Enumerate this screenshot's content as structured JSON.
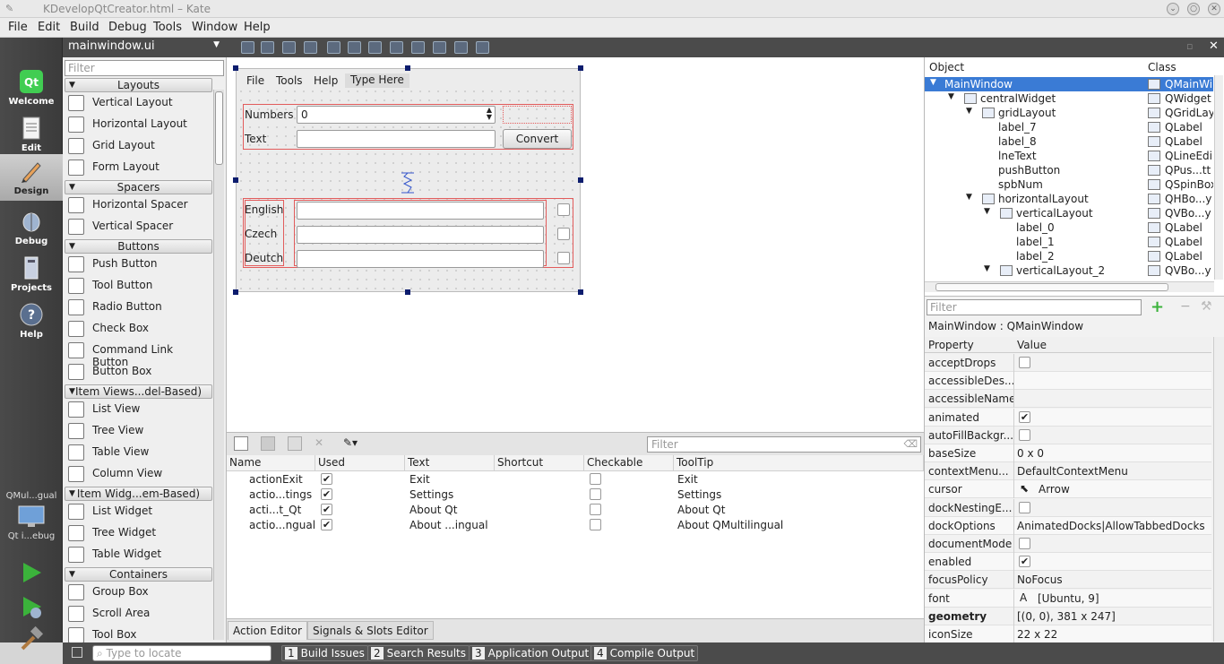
{
  "window": {
    "title": "KDevelopQtCreator.html – Kate"
  },
  "menu": [
    "File",
    "Edit",
    "Build",
    "Debug",
    "Tools",
    "Window",
    "Help"
  ],
  "modes": [
    {
      "label": "Welcome",
      "icon": "qt-logo-icon"
    },
    {
      "label": "Edit",
      "icon": "document-icon"
    },
    {
      "label": "Design",
      "icon": "pen-icon"
    },
    {
      "label": "Debug",
      "icon": "bug-icon"
    },
    {
      "label": "Projects",
      "icon": "folder-icon"
    },
    {
      "label": "Help",
      "icon": "help-icon"
    }
  ],
  "kit": {
    "name": "QMul...gual",
    "sub": "Qt i...ebug"
  },
  "editor": {
    "file": "mainwindow.ui"
  },
  "widgetbox": {
    "filter_placeholder": "Filter",
    "layouts": {
      "title": "Layouts",
      "items": [
        "Vertical Layout",
        "Horizontal Layout",
        "Grid Layout",
        "Form Layout"
      ]
    },
    "spacers": {
      "title": "Spacers",
      "items": [
        "Horizontal Spacer",
        "Vertical Spacer"
      ]
    },
    "buttons": {
      "title": "Buttons",
      "items": [
        "Push Button",
        "Tool Button",
        "Radio Button",
        "Check Box",
        "Command Link Button",
        "Button Box"
      ]
    },
    "itemviews": {
      "title": "Item Views...del-Based)",
      "items": [
        "List View",
        "Tree View",
        "Table View",
        "Column View"
      ]
    },
    "itemwidgets": {
      "title": "Item Widg...em-Based)",
      "items": [
        "List Widget",
        "Tree Widget",
        "Table Widget"
      ]
    },
    "containers": {
      "title": "Containers",
      "items": [
        "Group Box",
        "Scroll Area",
        "Tool Box"
      ]
    }
  },
  "form": {
    "menu": [
      "File",
      "Tools",
      "Help",
      "Type Here"
    ],
    "numbers_label": "Numbers",
    "numbers_value": "0",
    "text_label": "Text",
    "convert_label": "Convert",
    "english_label": "English",
    "czech_label": "Czech",
    "deutch_label": "Deutch"
  },
  "action_editor": {
    "filter_placeholder": "Filter",
    "columns": [
      "Name",
      "Used",
      "Text",
      "Shortcut",
      "Checkable",
      "ToolTip"
    ],
    "rows": [
      {
        "name": "actionExit",
        "used": true,
        "text": "Exit",
        "shortcut": "",
        "checkable": false,
        "tooltip": "Exit"
      },
      {
        "name": "actio...tings",
        "used": true,
        "text": "Settings",
        "shortcut": "",
        "checkable": false,
        "tooltip": "Settings"
      },
      {
        "name": "acti...t_Qt",
        "used": true,
        "text": "About Qt",
        "shortcut": "",
        "checkable": false,
        "tooltip": "About Qt"
      },
      {
        "name": "actio...ngual",
        "used": true,
        "text": "About ...ingual",
        "shortcut": "",
        "checkable": false,
        "tooltip": "About QMultilingual"
      }
    ],
    "tabs": [
      "Action Editor",
      "Signals & Slots Editor"
    ]
  },
  "object_inspector": {
    "columns": [
      "Object",
      "Class"
    ],
    "rows": [
      {
        "object": "MainWindow",
        "class": "QMainWindow",
        "level": 0,
        "arrow": "▼"
      },
      {
        "object": "centralWidget",
        "class": "QWidget",
        "level": 1,
        "arrow": "▼"
      },
      {
        "object": "gridLayout",
        "class": "QGridLay...",
        "level": 2,
        "arrow": "▼"
      },
      {
        "object": "label_7",
        "class": "QLabel",
        "level": 3,
        "arrow": ""
      },
      {
        "object": "label_8",
        "class": "QLabel",
        "level": 3,
        "arrow": ""
      },
      {
        "object": "lneText",
        "class": "QLineEdi...",
        "level": 3,
        "arrow": ""
      },
      {
        "object": "pushButton",
        "class": "QPus...tt",
        "level": 3,
        "arrow": ""
      },
      {
        "object": "spbNum",
        "class": "QSpinBox",
        "level": 3,
        "arrow": ""
      },
      {
        "object": "horizontalLayout",
        "class": "QHBo...y",
        "level": 2,
        "arrow": "▼"
      },
      {
        "object": "verticalLayout",
        "class": "QVBo...y",
        "level": 3,
        "arrow": "▼"
      },
      {
        "object": "label_0",
        "class": "QLabel",
        "level": 4,
        "arrow": ""
      },
      {
        "object": "label_1",
        "class": "QLabel",
        "level": 4,
        "arrow": ""
      },
      {
        "object": "label_2",
        "class": "QLabel",
        "level": 4,
        "arrow": ""
      },
      {
        "object": "verticalLayout_2",
        "class": "QVBo...y",
        "level": 3,
        "arrow": "▼"
      }
    ]
  },
  "property_editor": {
    "filter_placeholder": "Filter",
    "class_line": "MainWindow : QMainWindow",
    "columns": [
      "Property",
      "Value"
    ],
    "rows": [
      {
        "name": "acceptDrops",
        "value": "",
        "check": "off"
      },
      {
        "name": "accessibleDes...",
        "value": "",
        "check": ""
      },
      {
        "name": "accessibleName",
        "value": "",
        "check": ""
      },
      {
        "name": "animated",
        "value": "",
        "check": "on"
      },
      {
        "name": "autoFillBackgr...",
        "value": "",
        "check": "off"
      },
      {
        "name": "baseSize",
        "value": "0 x 0",
        "check": ""
      },
      {
        "name": "contextMenu...",
        "value": "DefaultContextMenu",
        "check": ""
      },
      {
        "name": "cursor",
        "value": "Arrow",
        "check": ""
      },
      {
        "name": "dockNestingE...",
        "value": "",
        "check": "off"
      },
      {
        "name": "dockOptions",
        "value": "AnimatedDocks|AllowTabbedDocks",
        "check": ""
      },
      {
        "name": "documentMode",
        "value": "",
        "check": "off"
      },
      {
        "name": "enabled",
        "value": "",
        "check": "on"
      },
      {
        "name": "focusPolicy",
        "value": "NoFocus",
        "check": ""
      },
      {
        "name": "font",
        "value": "[Ubuntu, 9]",
        "check": ""
      },
      {
        "name": "geometry",
        "value": "[(0, 0), 381 x 247]",
        "check": "",
        "bold": true
      },
      {
        "name": "iconSize",
        "value": "22 x 22",
        "check": ""
      }
    ]
  },
  "statusbar": {
    "locator_placeholder": "Type to locate",
    "panes": [
      {
        "num": "1",
        "label": "Build Issues"
      },
      {
        "num": "2",
        "label": "Search Results"
      },
      {
        "num": "3",
        "label": "Application Output"
      },
      {
        "num": "4",
        "label": "Compile Output"
      }
    ]
  },
  "colors": {
    "accent": "#3a7bd5",
    "dark_panel": "#4b4b4b",
    "layout_red": "#e25c5c"
  }
}
